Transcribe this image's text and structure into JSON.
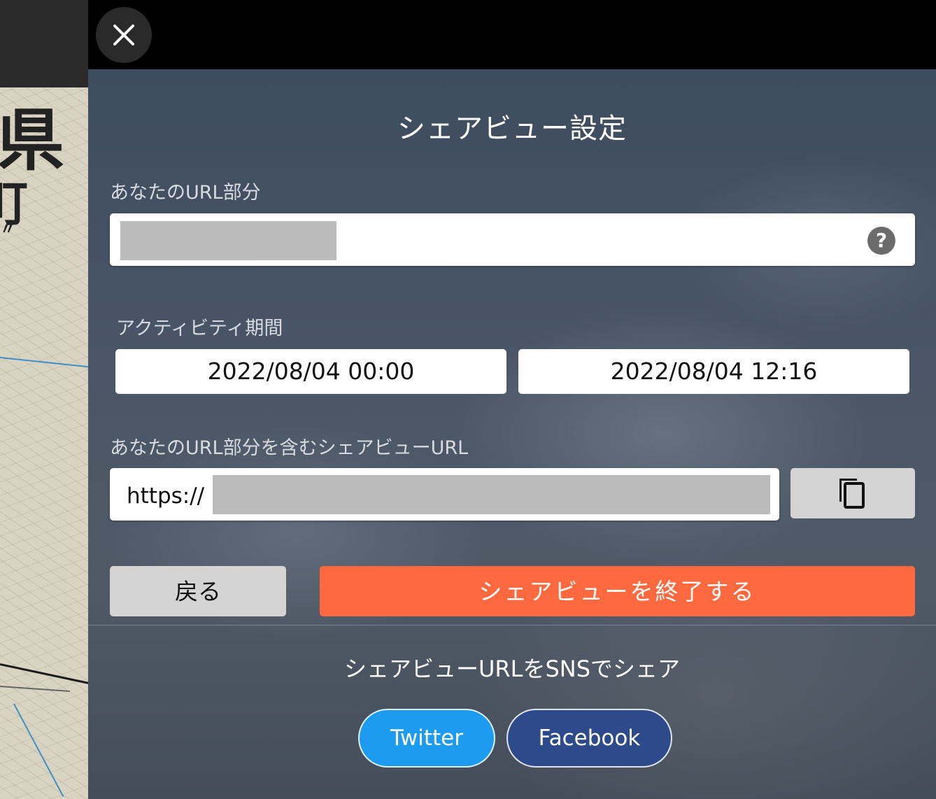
{
  "map": {
    "chars": [
      "県",
      "町",
      "〃"
    ]
  },
  "panel": {
    "title": "シェアビュー設定",
    "url_part": {
      "label": "あなたのURL部分",
      "help_icon": "?"
    },
    "activity_period": {
      "label": "アクティビティ期間",
      "start": "2022/08/04 00:00",
      "end": "2022/08/04 12:16"
    },
    "share_url": {
      "label": "あなたのURL部分を含むシェアビューURL",
      "prefix": "https://",
      "copy_icon": "copy-icon"
    },
    "buttons": {
      "back_label": "戻る",
      "end_share_label": "シェアビューを終了する"
    },
    "sns": {
      "title": "シェアビューURLをSNSでシェア",
      "twitter_label": "Twitter",
      "facebook_label": "Facebook"
    }
  },
  "colors": {
    "accent_orange": "#ff6940",
    "twitter_blue": "#1d9bf0",
    "facebook_blue": "#2d4b8a"
  }
}
